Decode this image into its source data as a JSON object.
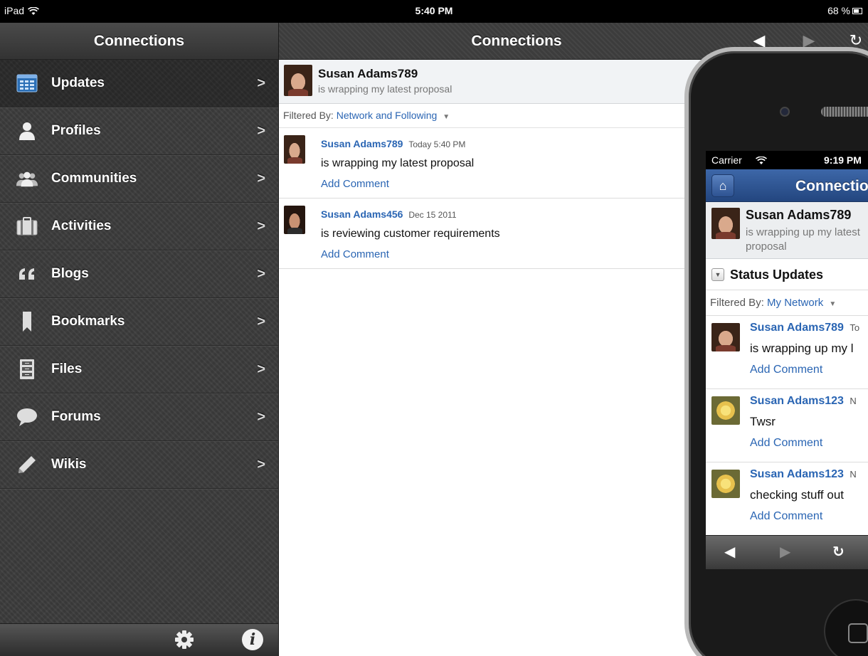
{
  "status_bar": {
    "device": "iPad",
    "time": "5:40 PM",
    "battery": "68 %"
  },
  "sidebar": {
    "title": "Connections",
    "items": [
      {
        "label": "Updates",
        "icon": "updates-icon",
        "selected": true
      },
      {
        "label": "Profiles",
        "icon": "profile-icon"
      },
      {
        "label": "Communities",
        "icon": "communities-icon"
      },
      {
        "label": "Activities",
        "icon": "activities-icon"
      },
      {
        "label": "Blogs",
        "icon": "quote-icon"
      },
      {
        "label": "Bookmarks",
        "icon": "bookmark-icon"
      },
      {
        "label": "Files",
        "icon": "file-cabinet-icon"
      },
      {
        "label": "Forums",
        "icon": "speech-bubble-icon"
      },
      {
        "label": "Wikis",
        "icon": "pencil-icon"
      }
    ],
    "chevron": ">",
    "footer": {
      "settings_icon": "gear-icon",
      "info_label": "i"
    }
  },
  "main": {
    "title": "Connections",
    "profile": {
      "name": "Susan Adams789",
      "status": "is wrapping my latest proposal"
    },
    "filter": {
      "label": "Filtered By:",
      "value": "Network and Following"
    },
    "feed": [
      {
        "author": "Susan Adams789",
        "time": "Today 5:40 PM",
        "text": "is wrapping my latest proposal",
        "action": "Add Comment"
      },
      {
        "author": "Susan Adams456",
        "time": "Dec 15 2011",
        "text": "is reviewing customer requirements",
        "action": "Add Comment"
      }
    ]
  },
  "phone": {
    "status": {
      "carrier": "Carrier",
      "time": "9:19 PM"
    },
    "title": "Connections",
    "profile": {
      "name": "Susan Adams789",
      "status": "is wrapping up my latest proposal"
    },
    "section_title": "Status Updates",
    "filter": {
      "label": "Filtered By:",
      "value": "My Network"
    },
    "feed": [
      {
        "author": "Susan Adams789",
        "time": "To",
        "text": "is wrapping up my l",
        "action": "Add Comment",
        "avatar": "woman"
      },
      {
        "author": "Susan Adams123",
        "time": "N",
        "text": "Twsr",
        "action": "Add Comment",
        "avatar": "flower"
      },
      {
        "author": "Susan Adams123",
        "time": "N",
        "text": "checking stuff out",
        "action": "Add Comment",
        "avatar": "flower"
      }
    ]
  },
  "colors": {
    "link": "#2a65b3",
    "sidebar_bg": "#3b3b3b",
    "phone_nav": "#2f5692"
  }
}
